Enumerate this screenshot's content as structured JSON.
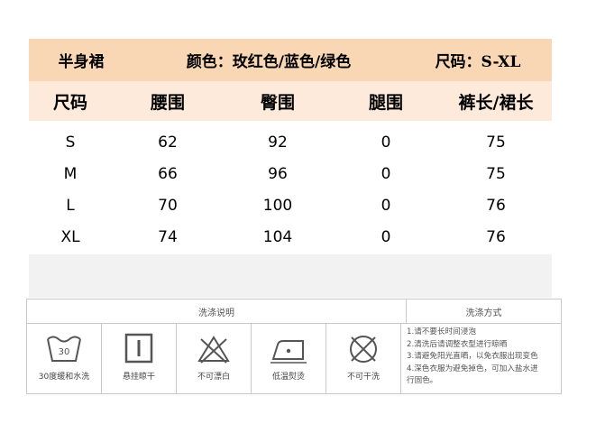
{
  "header": {
    "product": "半身裙",
    "colors": "颜色：玫红色/蓝色/绿色",
    "sizes": "尺码：S-XL"
  },
  "columns": [
    "尺码",
    "腰围",
    "臀围",
    "腿围",
    "裤长/裙长"
  ],
  "rows": [
    [
      "S",
      "62",
      "92",
      "0",
      "75"
    ],
    [
      "M",
      "66",
      "96",
      "0",
      "75"
    ],
    [
      "L",
      "70",
      "100",
      "0",
      "76"
    ],
    [
      "XL",
      "74",
      "104",
      "0",
      "76"
    ]
  ],
  "care": {
    "instructions_title": "洗涤说明",
    "method_title": "洗涤方式",
    "icons": [
      {
        "name": "wash-30-icon",
        "badge": "30",
        "label": "30度缓和水洗"
      },
      {
        "name": "hang-dry-icon",
        "label": "悬挂晾干"
      },
      {
        "name": "no-bleach-icon",
        "label": "不可漂白"
      },
      {
        "name": "low-iron-icon",
        "label": "低温熨烫"
      },
      {
        "name": "no-dry-clean-icon",
        "label": "不可干洗"
      }
    ],
    "notes": [
      "1.请不要长时间浸泡",
      "2.清洗后请调整衣型进行晾晒",
      "3.请避免阳光直晒，以免衣服出现变色",
      "4.深色衣服为避免掉色，可加入盐水进",
      "行固色。"
    ]
  }
}
